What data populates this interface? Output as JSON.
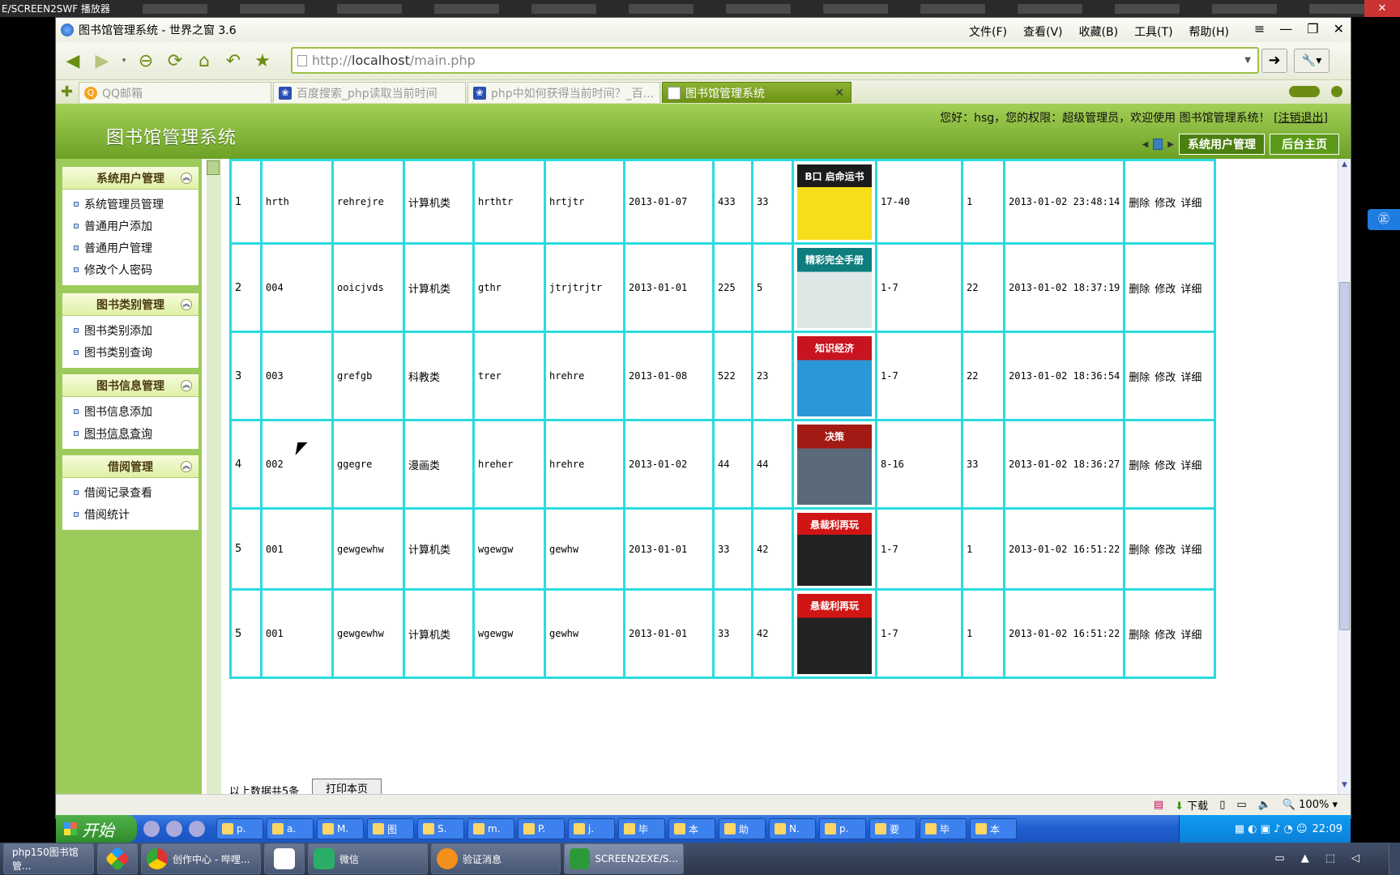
{
  "player": {
    "title": "E/SCREEN2SWF 播放器"
  },
  "browser": {
    "title": "图书馆管理系统 - 世界之窗 3.6",
    "menus": [
      "文件(F)",
      "查看(V)",
      "收藏(B)",
      "工具(T)",
      "帮助(H)"
    ],
    "controls": [
      "≡",
      "—",
      "❐",
      "✕"
    ],
    "url_prefix": "http://",
    "url_host": "localhost",
    "url_path": "/main.php",
    "tabs": [
      {
        "label": "QQ邮箱",
        "active": false
      },
      {
        "label": "百度搜索_php读取当前时间",
        "active": false
      },
      {
        "label": "php中如何获得当前时间？_百...",
        "active": false
      },
      {
        "label": "图书馆管理系统",
        "active": true
      }
    ]
  },
  "header": {
    "title": "图书馆管理系统",
    "welcome": "您好：hsg，您的权限：超级管理员，欢迎使用 图书馆管理系统！",
    "logout": "[注销退出]",
    "tab_active": "系统用户管理",
    "tab_home": "后台主页"
  },
  "sidebar": {
    "groups": [
      {
        "title": "系统用户管理",
        "items": [
          "系统管理员管理",
          "普通用户添加",
          "普通用户管理",
          "修改个人密码"
        ]
      },
      {
        "title": "图书类别管理",
        "items": [
          "图书类别添加",
          "图书类别查询"
        ]
      },
      {
        "title": "图书信息管理",
        "items": [
          "图书信息添加",
          "图书信息查询"
        ]
      },
      {
        "title": "借阅管理",
        "items": [
          "借阅记录查看",
          "借阅统计"
        ]
      }
    ]
  },
  "table": {
    "ops": [
      "删除",
      "修改",
      "详细"
    ],
    "rows": [
      {
        "id": "1",
        "isbn": "hrth",
        "name": "rehrejre",
        "type": "计算机类",
        "author": "hrthtr",
        "publisher": "hrtjtr",
        "pubdate": "2013-01-07",
        "price": "433",
        "count": "33",
        "cover": {
          "top": "#1b1b1b",
          "mid": "#f6de1a",
          "text": "B口 启命运书"
        },
        "place": "17-40",
        "stock": "1",
        "added": "2013-01-02 23:48:14"
      },
      {
        "id": "2",
        "isbn": "004",
        "name": "ooicjvds",
        "type": "计算机类",
        "author": "gthr",
        "publisher": "jtrjtrjtr",
        "pubdate": "2013-01-01",
        "price": "225",
        "count": "5",
        "cover": {
          "top": "#0d7d7d",
          "mid": "#dfe6e6",
          "text": "精彩完全手册"
        },
        "place": "1-7",
        "stock": "22",
        "added": "2013-01-02 18:37:19"
      },
      {
        "id": "3",
        "isbn": "003",
        "name": "grefgb",
        "type": "科教类",
        "author": "trer",
        "publisher": "hrehre",
        "pubdate": "2013-01-08",
        "price": "522",
        "count": "23",
        "cover": {
          "top": "#c8141e",
          "mid": "#2a97d6",
          "text": "知识经济"
        },
        "place": "1-7",
        "stock": "22",
        "added": "2013-01-02 18:36:54"
      },
      {
        "id": "4",
        "isbn": "002",
        "name": "ggegre",
        "type": "漫画类",
        "author": "hreher",
        "publisher": "hrehre",
        "pubdate": "2013-01-02",
        "price": "44",
        "count": "44",
        "cover": {
          "top": "#a31a14",
          "mid": "#5b6a7a",
          "text": "决策"
        },
        "place": "8-16",
        "stock": "33",
        "added": "2013-01-02 18:36:27"
      },
      {
        "id": "5",
        "isbn": "001",
        "name": "gewgewhw",
        "type": "计算机类",
        "author": "wgewgw",
        "publisher": "gewhw",
        "pubdate": "2013-01-01",
        "price": "33",
        "count": "42",
        "cover": {
          "top": "#d01515",
          "mid": "#222",
          "text": "悬裁利再玩"
        },
        "place": "1-7",
        "stock": "1",
        "added": "2013-01-02 16:51:22"
      },
      {
        "id": "5",
        "isbn": "001",
        "name": "gewgewhw",
        "type": "计算机类",
        "author": "wgewgw",
        "publisher": "gewhw",
        "pubdate": "2013-01-01",
        "price": "33",
        "count": "42",
        "cover": {
          "top": "#d01515",
          "mid": "#222",
          "text": "悬裁利再玩"
        },
        "place": "1-7",
        "stock": "1",
        "added": "2013-01-02 16:51:22"
      }
    ],
    "footer_text": "以上数据共5条",
    "print_button": "打印本页"
  },
  "statusbar": {
    "download": "下载",
    "zoom": "100%"
  },
  "xp_taskbar": {
    "start": "开始",
    "tasks": [
      "p.",
      "a.",
      "M.",
      "图",
      "S.",
      "m.",
      "P.",
      "j.",
      "毕",
      "本",
      "助",
      "N.",
      "p.",
      "要",
      "毕",
      "本"
    ],
    "clock": "22:09"
  },
  "win7_taskbar": {
    "tasks": [
      "php150图书馆管...",
      "",
      "创作中心 - 哔哩...",
      "",
      "微信",
      "验证消息",
      "SCREEN2EXE/S..."
    ]
  },
  "side_widget": {
    "label": "㊣"
  }
}
